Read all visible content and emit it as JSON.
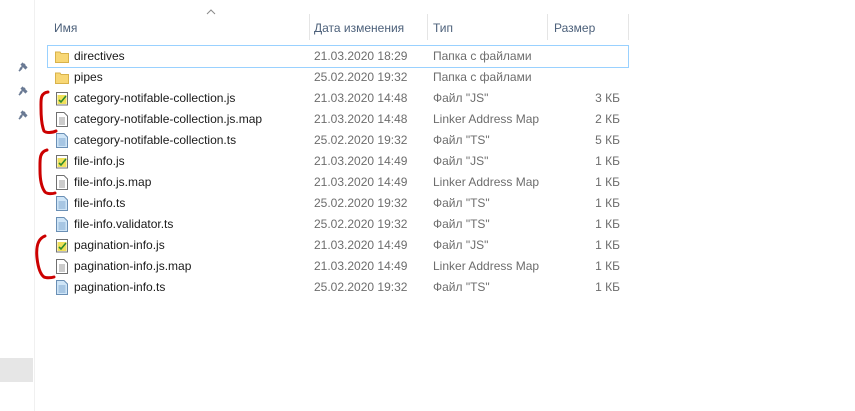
{
  "header": {
    "col_name": "Имя",
    "col_date": "Дата изменения",
    "col_type": "Тип",
    "col_size": "Размер"
  },
  "files": [
    {
      "name": "directives",
      "date": "21.03.2020 18:29",
      "type": "Папка с файлами",
      "size": "",
      "icon": "folder-icon"
    },
    {
      "name": "pipes",
      "date": "25.02.2020 19:32",
      "type": "Папка с файлами",
      "size": "",
      "icon": "folder-icon"
    },
    {
      "name": "category-notifable-collection.js",
      "date": "21.03.2020 14:48",
      "type": "Файл \"JS\"",
      "size": "3 КБ",
      "icon": "js-file-icon"
    },
    {
      "name": "category-notifable-collection.js.map",
      "date": "21.03.2020 14:48",
      "type": "Linker Address Map",
      "size": "2 КБ",
      "icon": "map-file-icon"
    },
    {
      "name": "category-notifable-collection.ts",
      "date": "25.02.2020 19:32",
      "type": "Файл \"TS\"",
      "size": "5 КБ",
      "icon": "ts-file-icon"
    },
    {
      "name": "file-info.js",
      "date": "21.03.2020 14:49",
      "type": "Файл \"JS\"",
      "size": "1 КБ",
      "icon": "js-file-icon"
    },
    {
      "name": "file-info.js.map",
      "date": "21.03.2020 14:49",
      "type": "Linker Address Map",
      "size": "1 КБ",
      "icon": "map-file-icon"
    },
    {
      "name": "file-info.ts",
      "date": "25.02.2020 19:32",
      "type": "Файл \"TS\"",
      "size": "1 КБ",
      "icon": "ts-file-icon"
    },
    {
      "name": "file-info.validator.ts",
      "date": "25.02.2020 19:32",
      "type": "Файл \"TS\"",
      "size": "1 КБ",
      "icon": "ts-file-icon"
    },
    {
      "name": "pagination-info.js",
      "date": "21.03.2020 14:49",
      "type": "Файл \"JS\"",
      "size": "1 КБ",
      "icon": "js-file-icon"
    },
    {
      "name": "pagination-info.js.map",
      "date": "21.03.2020 14:49",
      "type": "Linker Address Map",
      "size": "1 КБ",
      "icon": "map-file-icon"
    },
    {
      "name": "pagination-info.ts",
      "date": "25.02.2020 19:32",
      "type": "Файл \"TS\"",
      "size": "1 КБ",
      "icon": "ts-file-icon"
    }
  ],
  "colors": {
    "header_text": "#4c607a",
    "selection_border": "#99d1ff",
    "folder": "#f8d775",
    "annotation_red": "#cc0000"
  }
}
